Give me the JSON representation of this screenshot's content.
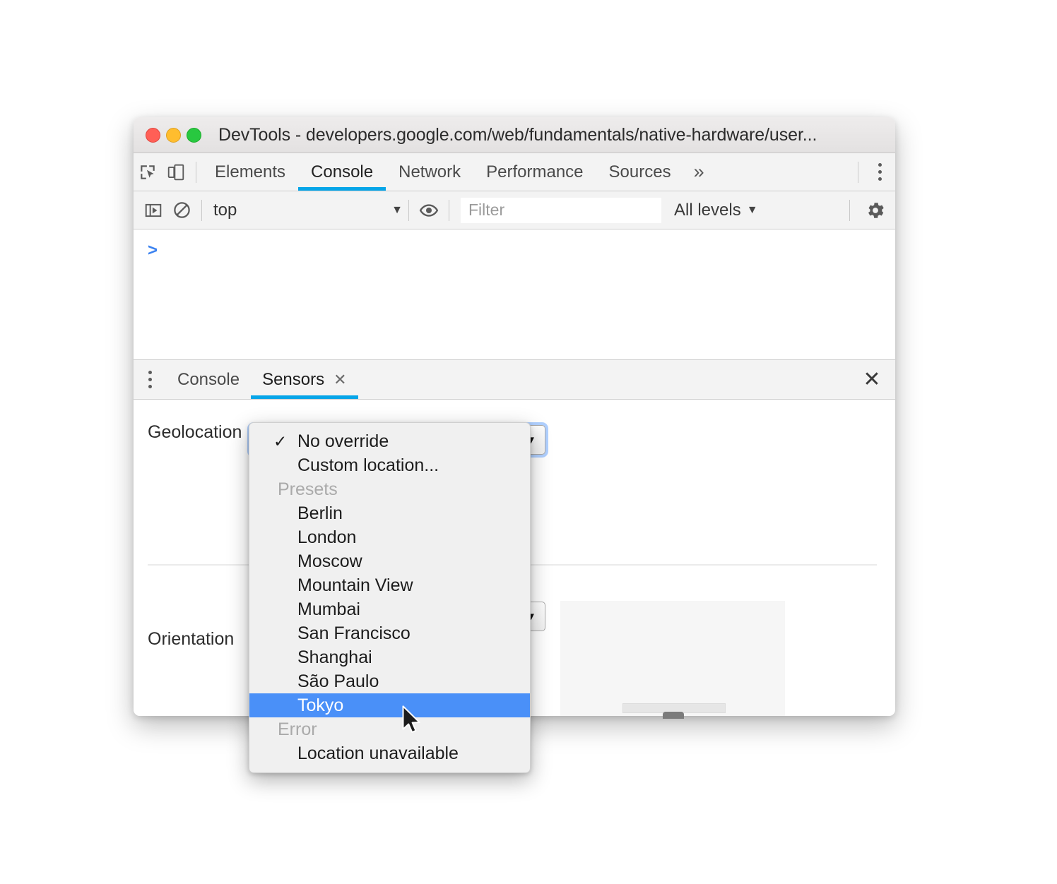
{
  "window": {
    "title": "DevTools - developers.google.com/web/fundamentals/native-hardware/user...",
    "traffic_lights": {
      "close": "close-button",
      "minimize": "minimize-button",
      "zoom": "zoom-button"
    },
    "colors": {
      "close": "#ff5f56",
      "minimize": "#ffbd2e",
      "zoom": "#28c840",
      "accent_tab_underline": "#06a5e8",
      "menu_highlight": "#4a90f8",
      "prompt_chevron": "#3b82f0"
    }
  },
  "main_tabs": {
    "items": [
      {
        "label": "Elements",
        "active": false
      },
      {
        "label": "Console",
        "active": true
      },
      {
        "label": "Network",
        "active": false
      },
      {
        "label": "Performance",
        "active": false
      },
      {
        "label": "Sources",
        "active": false
      }
    ],
    "more_label": "»",
    "inspect_icon": "inspect-element-icon",
    "device_icon": "device-toolbar-icon",
    "menu_icon": "main-menu-kebab-icon"
  },
  "console_toolbar": {
    "sidebar_toggle_icon": "console-sidebar-toggle-icon",
    "clear_icon": "clear-console-icon",
    "context_value": "top",
    "context_caret": "▼",
    "eye_icon": "live-expression-eye-icon",
    "filter_placeholder": "Filter",
    "filter_value": "",
    "levels_label": "All levels",
    "levels_caret": "▼",
    "settings_icon": "settings-gear-icon"
  },
  "console_output": {
    "prompt": ">"
  },
  "drawer": {
    "menu_icon": "drawer-menu-kebab-icon",
    "tabs": [
      {
        "label": "Console",
        "active": false,
        "closable": false
      },
      {
        "label": "Sensors",
        "active": true,
        "closable": true,
        "close_glyph": "✕"
      }
    ],
    "close_glyph": "✕",
    "close_name": "close-drawer-button"
  },
  "sensors": {
    "geolocation": {
      "label": "Geolocation",
      "selected_value": "No override",
      "caret": "▼"
    },
    "orientation": {
      "label": "Orientation",
      "selected_value": "",
      "caret": "▼"
    }
  },
  "dropdown": {
    "items": [
      {
        "label": "No override",
        "type": "option",
        "checked": true,
        "selected": false
      },
      {
        "label": "Custom location...",
        "type": "option",
        "checked": false,
        "selected": false
      },
      {
        "label": "Presets",
        "type": "group",
        "checked": false,
        "selected": false
      },
      {
        "label": "Berlin",
        "type": "option-indent",
        "checked": false,
        "selected": false
      },
      {
        "label": "London",
        "type": "option-indent",
        "checked": false,
        "selected": false
      },
      {
        "label": "Moscow",
        "type": "option-indent",
        "checked": false,
        "selected": false
      },
      {
        "label": "Mountain View",
        "type": "option-indent",
        "checked": false,
        "selected": false
      },
      {
        "label": "Mumbai",
        "type": "option-indent",
        "checked": false,
        "selected": false
      },
      {
        "label": "San Francisco",
        "type": "option-indent",
        "checked": false,
        "selected": false
      },
      {
        "label": "Shanghai",
        "type": "option-indent",
        "checked": false,
        "selected": false
      },
      {
        "label": "São Paulo",
        "type": "option-indent",
        "checked": false,
        "selected": false
      },
      {
        "label": "Tokyo",
        "type": "option-indent",
        "checked": false,
        "selected": true
      },
      {
        "label": "Error",
        "type": "group",
        "checked": false,
        "selected": false
      },
      {
        "label": "Location unavailable",
        "type": "option-indent",
        "checked": false,
        "selected": false
      }
    ],
    "check_glyph": "✓"
  },
  "cursor": {
    "name": "mouse-pointer"
  }
}
